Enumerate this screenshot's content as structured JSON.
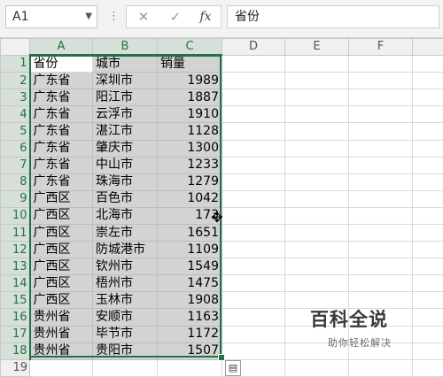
{
  "formula_bar": {
    "name_box": "A1",
    "separator": "⋮",
    "cancel_icon": "✕",
    "enter_icon": "✓",
    "fx_label": "fx",
    "formula_value": "省份"
  },
  "columns": [
    "A",
    "B",
    "C",
    "D",
    "E",
    "F"
  ],
  "rows": [
    {
      "num": "1",
      "a": "省份",
      "b": "城市",
      "c": "销量"
    },
    {
      "num": "2",
      "a": "广东省",
      "b": "深圳市",
      "c": "1989"
    },
    {
      "num": "3",
      "a": "广东省",
      "b": "阳江市",
      "c": "1887"
    },
    {
      "num": "4",
      "a": "广东省",
      "b": "云浮市",
      "c": "1910"
    },
    {
      "num": "5",
      "a": "广东省",
      "b": "湛江市",
      "c": "1128"
    },
    {
      "num": "6",
      "a": "广东省",
      "b": "肇庆市",
      "c": "1300"
    },
    {
      "num": "7",
      "a": "广东省",
      "b": "中山市",
      "c": "1233"
    },
    {
      "num": "8",
      "a": "广东省",
      "b": "珠海市",
      "c": "1279"
    },
    {
      "num": "9",
      "a": "广西区",
      "b": "百色市",
      "c": "1042"
    },
    {
      "num": "10",
      "a": "广西区",
      "b": "北海市",
      "c": "173"
    },
    {
      "num": "11",
      "a": "广西区",
      "b": "崇左市",
      "c": "1651"
    },
    {
      "num": "12",
      "a": "广西区",
      "b": "防城港市",
      "c": "1109"
    },
    {
      "num": "13",
      "a": "广西区",
      "b": "钦州市",
      "c": "1549"
    },
    {
      "num": "14",
      "a": "广西区",
      "b": "梧州市",
      "c": "1475"
    },
    {
      "num": "15",
      "a": "广西区",
      "b": "玉林市",
      "c": "1908"
    },
    {
      "num": "16",
      "a": "贵州省",
      "b": "安顺市",
      "c": "1163"
    },
    {
      "num": "17",
      "a": "贵州省",
      "b": "毕节市",
      "c": "1172"
    },
    {
      "num": "18",
      "a": "贵州省",
      "b": "贵阳市",
      "c": "1507"
    },
    {
      "num": "19",
      "a": "",
      "b": "",
      "c": ""
    }
  ],
  "watermark": {
    "title": "百科全说",
    "subtitle": "助你轻松解决"
  },
  "colors": {
    "selection_border": "#217346",
    "selected_fill": "#d3d3d3"
  }
}
